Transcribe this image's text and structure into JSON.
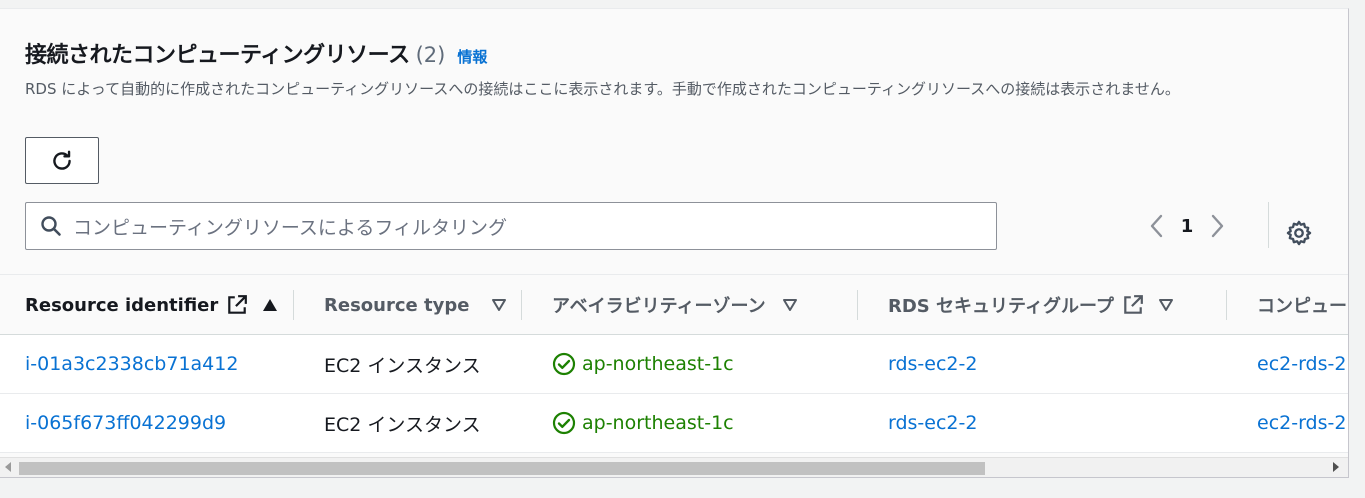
{
  "section": {
    "title": "接続されたコンピューティングリソース",
    "count": "(2)",
    "info_label": "情報",
    "description": "RDS によって自動的に作成されたコンピューティングリソースへの接続はここに表示されます。手動で作成されたコンピューティングリソースへの接続は表示されません。"
  },
  "toolbar": {
    "refresh_icon": "refresh-icon"
  },
  "search": {
    "placeholder": "コンピューティングリソースによるフィルタリング",
    "icon": "search-icon"
  },
  "pagination": {
    "current_page": "1",
    "prev_icon": "chevron-left-icon",
    "next_icon": "chevron-right-icon",
    "settings_icon": "gear-icon"
  },
  "table": {
    "columns": [
      {
        "label": "Resource identifier",
        "sort": "ascending",
        "external": true
      },
      {
        "label": "Resource type",
        "sort": "none"
      },
      {
        "label": "アベイラビリティーゾーン",
        "sort": "none"
      },
      {
        "label": "RDS セキュリティグループ",
        "sort": "none",
        "external": true
      },
      {
        "label": "コンピュー",
        "sort": "none"
      }
    ],
    "rows": [
      {
        "resource_id": "i-01a3c2338cb71a412",
        "resource_type": "EC2 インスタンス",
        "az": "ap-northeast-1c",
        "rds_sg": "rds-ec2-2",
        "compute_sg": "ec2-rds-2"
      },
      {
        "resource_id": "i-065f673ff042299d9",
        "resource_type": "EC2 インスタンス",
        "az": "ap-northeast-1c",
        "rds_sg": "rds-ec2-2",
        "compute_sg": "ec2-rds-2"
      }
    ]
  },
  "colors": {
    "link": "#0972d3",
    "success": "#1d8102",
    "text": "#16191f",
    "muted": "#545b64"
  }
}
